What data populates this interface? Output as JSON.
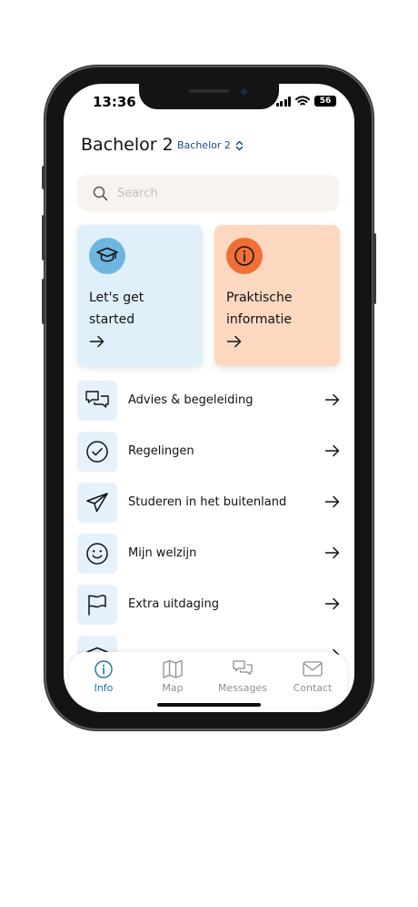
{
  "status_bar": {
    "time": "13:36",
    "battery": "56"
  },
  "header": {
    "title": "Bachelor 2",
    "year_select": "Bachelor 2"
  },
  "search": {
    "placeholder": "Search"
  },
  "cards": [
    {
      "line1": "Let's get",
      "line2": "started",
      "icon": "graduation-cap-icon",
      "color": "#dff0fb"
    },
    {
      "line1": "Praktische",
      "line2": "informatie",
      "icon": "info-icon",
      "color": "#fcd8c0"
    }
  ],
  "list": [
    {
      "label": "Advies & begeleiding",
      "icon": "chat-bubbles-icon"
    },
    {
      "label": "Regelingen",
      "icon": "check-circle-icon"
    },
    {
      "label": "Studeren in het buitenland",
      "icon": "paper-plane-icon"
    },
    {
      "label": "Mijn welzijn",
      "icon": "smiley-icon"
    },
    {
      "label": "Extra uitdaging",
      "icon": "flag-icon"
    }
  ],
  "tabs": [
    {
      "label": "Info",
      "icon": "info-icon",
      "active": true
    },
    {
      "label": "Map",
      "icon": "map-icon",
      "active": false
    },
    {
      "label": "Messages",
      "icon": "messages-icon",
      "active": false
    },
    {
      "label": "Contact",
      "icon": "mail-icon",
      "active": false
    }
  ],
  "colors": {
    "accent": "#1a73a6",
    "icon_bg": "#e5f2fb"
  }
}
